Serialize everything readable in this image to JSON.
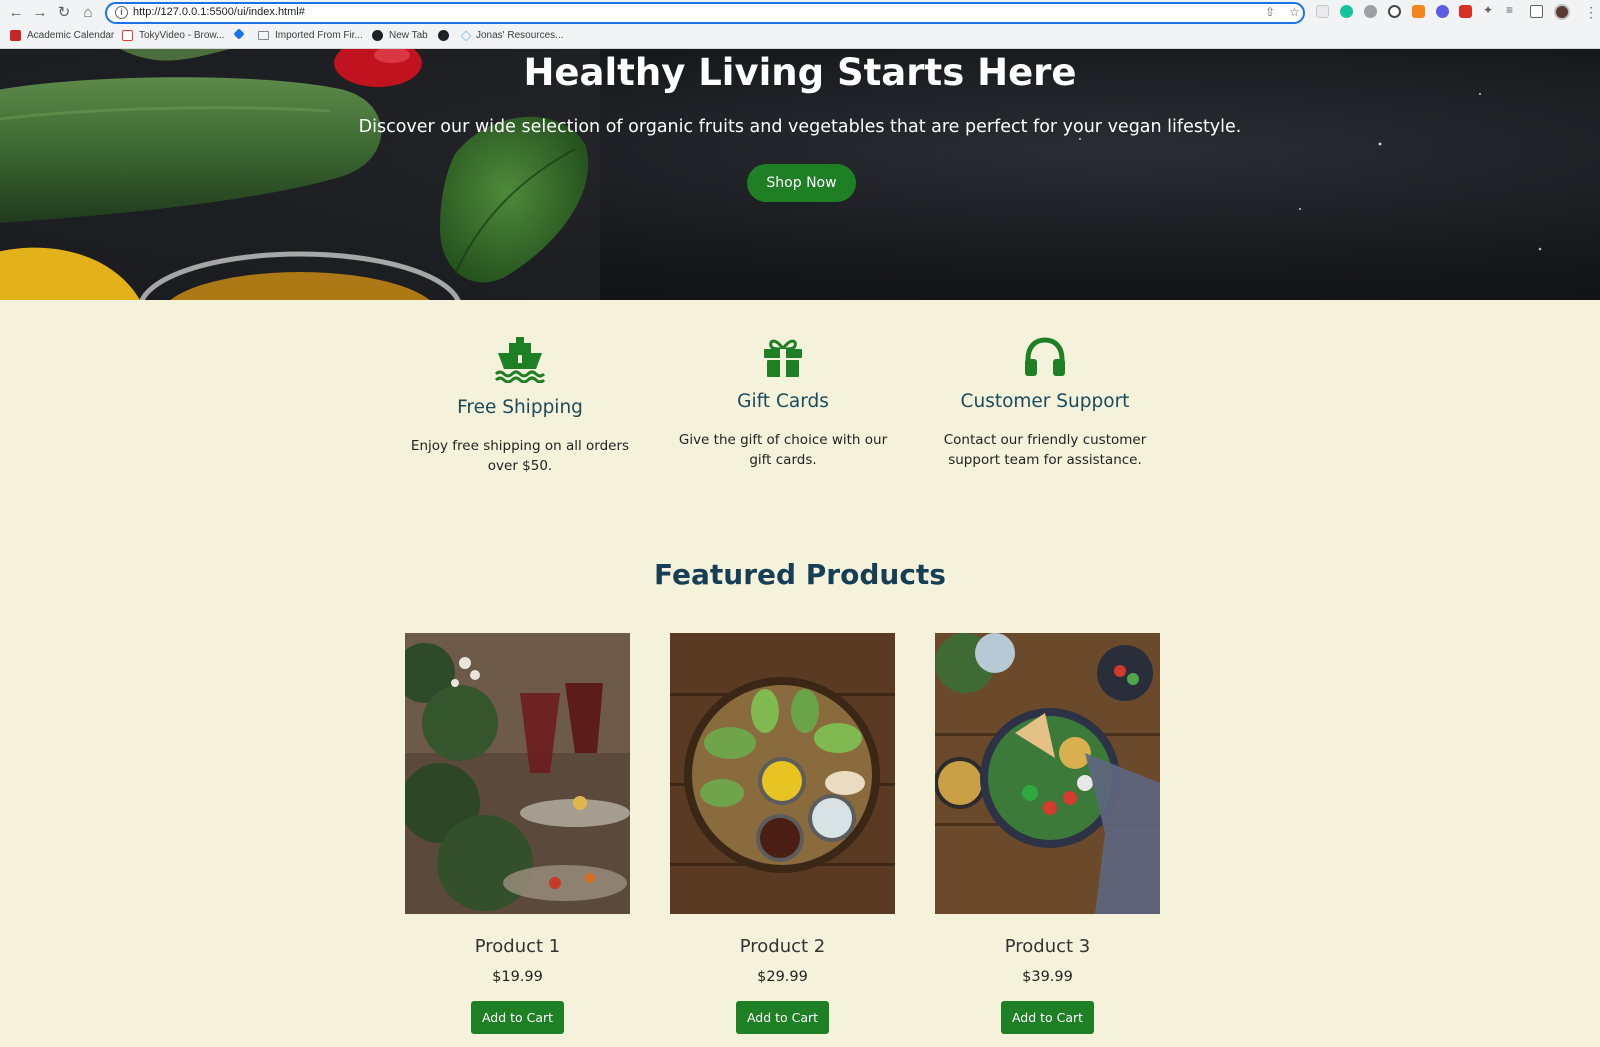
{
  "browser": {
    "url": "http://127.0.0.1:5500/ui/index.html#",
    "bookmarks": [
      {
        "label": "Academic Calendar",
        "color": "#c62828"
      },
      {
        "label": "TokyVideo - Brow...",
        "color": "#e53935"
      },
      {
        "label": "",
        "color": "#1a73e8"
      },
      {
        "label": "Imported From Fir...",
        "color": "#80868b"
      },
      {
        "label": "New Tab",
        "color": "#202124"
      },
      {
        "label": "",
        "color": "#202124"
      },
      {
        "label": "Jonas' Resources...",
        "color": "#90caf9"
      }
    ],
    "extension_icons": [
      "extension-blank-icon",
      "grammarly-icon",
      "extension-gray-icon",
      "wordpress-icon",
      "metamask-icon",
      "extension-purple-icon",
      "extension-red-icon",
      "puzzle-icon",
      "reading-list-icon",
      "side-panel-icon"
    ]
  },
  "hero": {
    "title": "Healthy Living Starts Here",
    "subtitle": "Discover our wide selection of organic fruits and vegetables that are perfect for your vegan lifestyle.",
    "cta_label": "Shop Now"
  },
  "features": [
    {
      "icon": "ship-icon",
      "title": "Free Shipping",
      "text": "Enjoy free shipping on all orders over $50."
    },
    {
      "icon": "gift-icon",
      "title": "Gift Cards",
      "text": "Give the gift of choice with our gift cards."
    },
    {
      "icon": "headphones-icon",
      "title": "Customer Support",
      "text": "Contact our friendly customer support team for assistance."
    }
  ],
  "featured_title": "Featured Products",
  "products": [
    {
      "name": "Product 1",
      "price": "$19.99",
      "button": "Add to Cart"
    },
    {
      "name": "Product 2",
      "price": "$29.99",
      "button": "Add to Cart"
    },
    {
      "name": "Product 3",
      "price": "$39.99",
      "button": "Add to Cart"
    }
  ],
  "colors": {
    "accent_green": "#1e7f25",
    "page_background": "#f5f2dc",
    "heading_blue": "#1b4a5a"
  }
}
